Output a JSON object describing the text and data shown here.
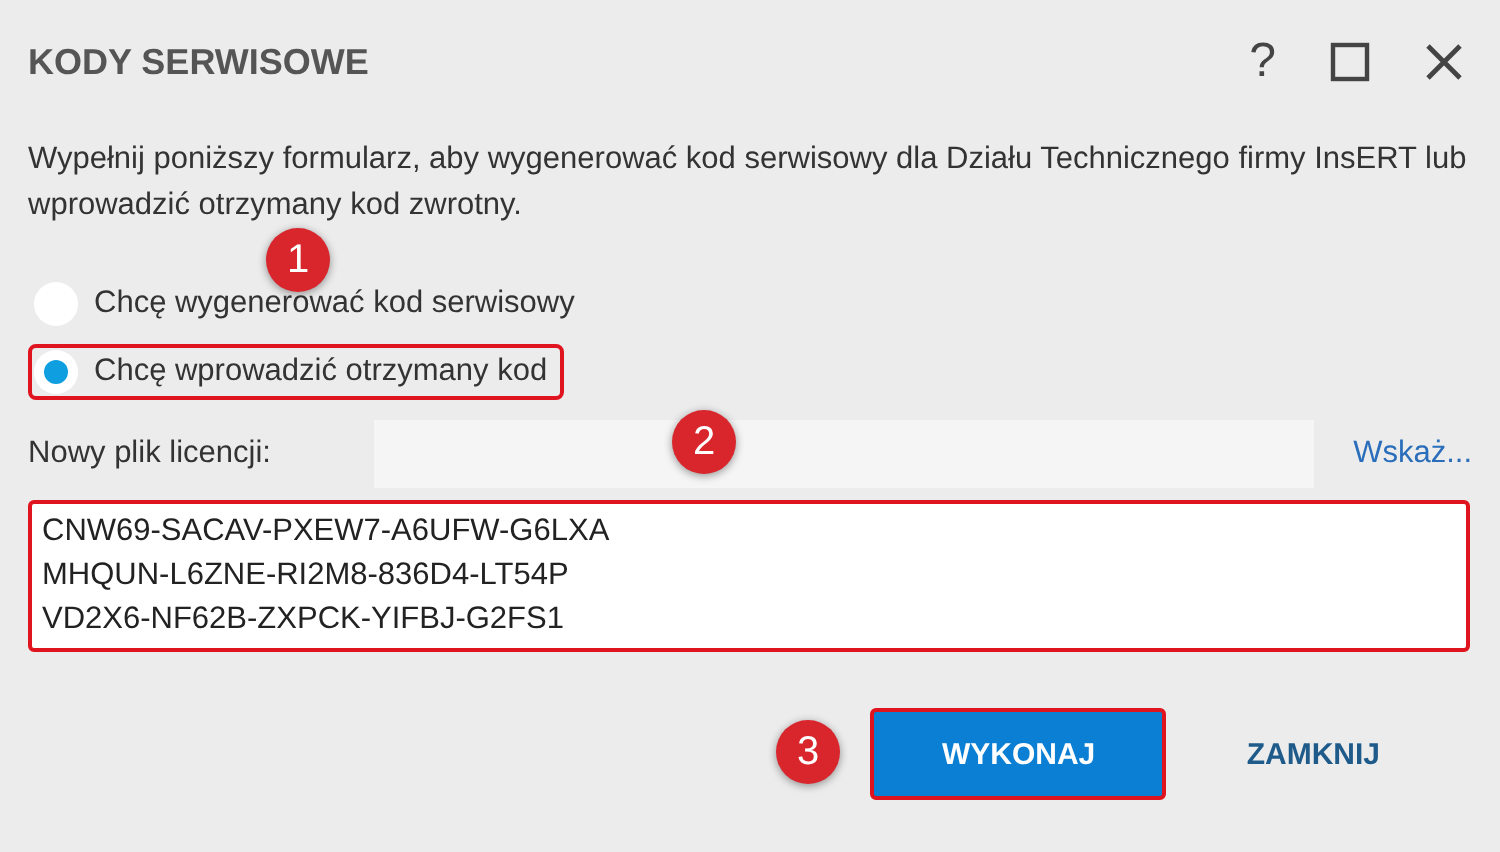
{
  "window": {
    "title": "KODY SERWISOWE",
    "help": "?"
  },
  "description": "Wypełnij poniższy formularz, aby wygenerować kod serwisowy dla Działu Technicznego firmy InsERT lub wprowadzić otrzymany kod zwrotny.",
  "options": [
    {
      "label": "Chcę wygenerować kod serwisowy",
      "selected": false,
      "highlighted": false
    },
    {
      "label": "Chcę wprowadzić otrzymany kod",
      "selected": true,
      "highlighted": true
    }
  ],
  "license": {
    "label": "Nowy plik licencji:",
    "link": "Wskaż..."
  },
  "code_field": {
    "value": [
      "CNW69-SACAV-PXEW7-A6UFW-G6LXA",
      "MHQUN-L6ZNE-RI2M8-836D4-LT54P",
      "VD2X6-NF62B-ZXPCK-YIFBJ-G2FS1"
    ],
    "highlighted": true
  },
  "buttons": [
    {
      "label": "WYKONAJ",
      "kind": "primary",
      "highlighted": true
    },
    {
      "label": "ZAMKNIJ",
      "kind": "text",
      "highlighted": false
    }
  ],
  "callouts": [
    "1",
    "2",
    "3"
  ]
}
